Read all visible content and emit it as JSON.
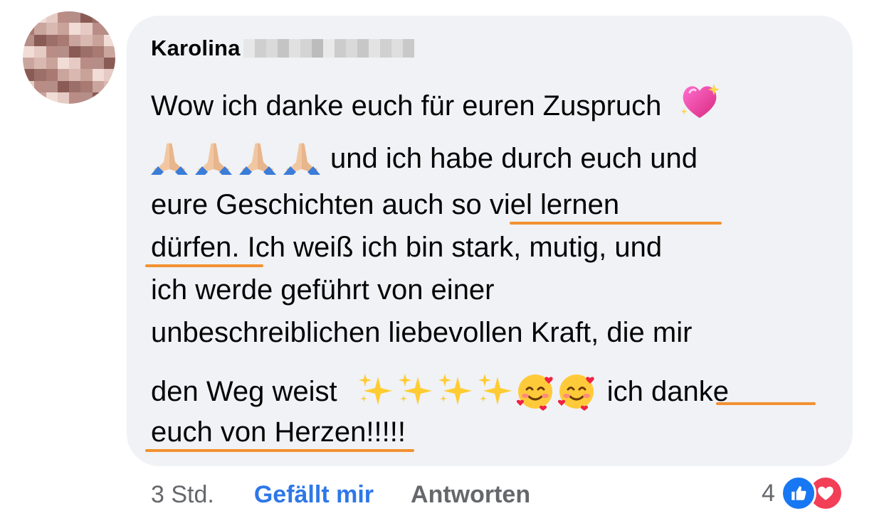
{
  "comment": {
    "author_name": "Karolina",
    "lines": [
      "Wow ich danke euch für euren Zuspruch",
      "und ich habe durch euch und",
      "eure Geschichten auch so viel lernen",
      "dürfen. Ich weiß ich bin stark, mutig, und",
      "ich werde geführt von einer",
      "unbeschreiblichen liebevollen Kraft, die mir",
      "den Weg weist",
      "ich danke",
      "euch von Herzen!!!!!"
    ],
    "emoji": [
      "sparkling-heart",
      "folded-hands",
      "sparkles",
      "smiling-face-with-hearts"
    ]
  },
  "footer": {
    "time": "3 Std.",
    "like_label": "Gefällt mir",
    "reply_label": "Antworten",
    "reaction_count": "4",
    "reactions": [
      "like-icon",
      "love-icon"
    ]
  },
  "colors": {
    "bubble_bg": "#f0f2f5",
    "like_blue": "#2d77e8",
    "underline_orange": "#f29131",
    "love_red": "#f33e58"
  }
}
